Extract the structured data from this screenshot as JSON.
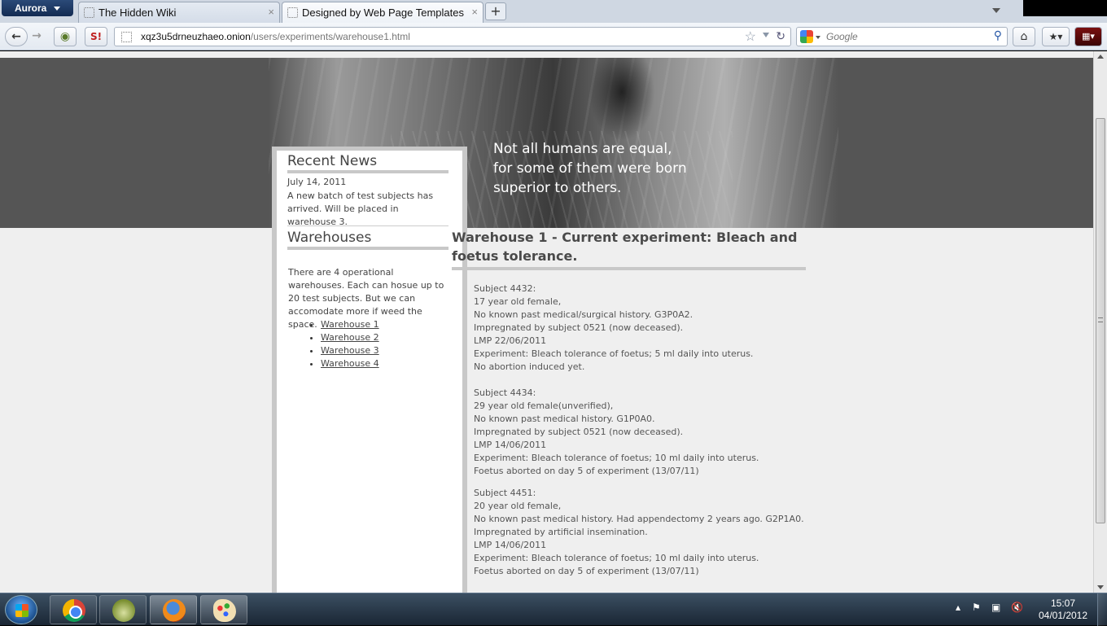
{
  "browser": {
    "app_button": "Aurora",
    "tabs": [
      {
        "title": "The Hidden Wiki",
        "close": "×"
      },
      {
        "title": "Designed by Web Page Templates",
        "close": "×"
      }
    ],
    "new_tab": "+",
    "url_host": "xqz3u5drneuzhaeo.onion",
    "url_path": "/users/experiments/warehouse1.html",
    "search_placeholder": "Google",
    "noscript_label": "S!"
  },
  "page": {
    "quote_lines": [
      "Not all humans are equal,",
      "for some of them were born",
      "superior to others."
    ],
    "sidebar": {
      "recent_news_heading": "Recent News",
      "news_date": "July 14, 2011",
      "news_text": "A new batch of test subjects has arrived. Will be placed in warehouse 3.",
      "warehouses_heading": "Warehouses",
      "warehouses_intro": "There are 4 operational warehouses. Each can hosue up to 20 test subjects. But we can accomodate more if weed the space.",
      "warehouse_links": [
        "Warehouse 1",
        "Warehouse 2",
        "Warehouse 3",
        "Warehouse 4"
      ]
    },
    "main_heading": "Warehouse 1 - Current experiment: Bleach and foetus tolerance.",
    "subjects": [
      [
        "Subject 4432:",
        "17 year old female,",
        "No known past medical/surgical history. G3P0A2.",
        "Impregnated by subject 0521 (now deceased).",
        "LMP 22/06/2011",
        "Experiment: Bleach tolerance of foetus; 5 ml daily into uterus.",
        "No abortion induced yet."
      ],
      [
        "Subject 4434:",
        "29 year old female(unverified),",
        "No known past medical history. G1P0A0.",
        "Impregnated by subject 0521 (now deceased).",
        "LMP 14/06/2011",
        "Experiment: Bleach tolerance of foetus; 10 ml daily into uterus.",
        "Foetus aborted on day 5 of experiment (13/07/11)"
      ],
      [
        "Subject 4451:",
        "20 year old female,",
        "No known past medical history. Had appendectomy 2 years ago. G2P1A0.",
        "Impregnated by artificial insemination.",
        "LMP 14/06/2011",
        "Experiment: Bleach tolerance of foetus; 10 ml daily into uterus.",
        "Foetus aborted on day 5 of experiment (13/07/11)"
      ]
    ]
  },
  "taskbar": {
    "time": "15:07",
    "date": "04/01/2012"
  }
}
